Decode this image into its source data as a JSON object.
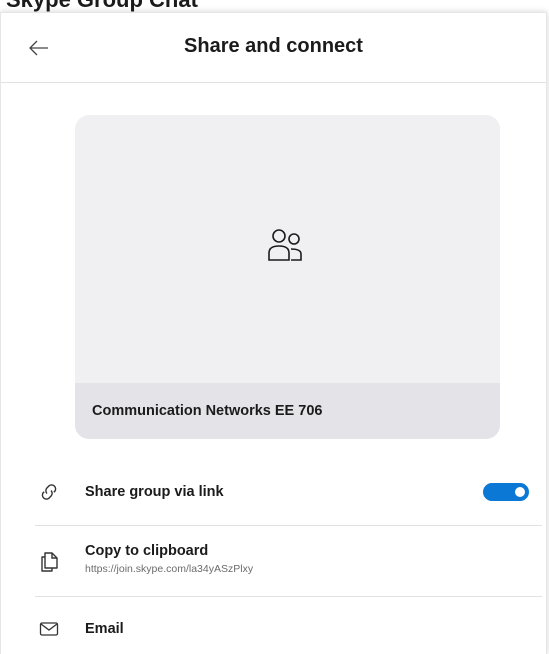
{
  "background_window": {
    "partial_title": "Skype Group Chat"
  },
  "header": {
    "back_icon": "arrow-left-icon",
    "title": "Share and connect"
  },
  "group_card": {
    "icon": "group-people-icon",
    "name": "Communication Networks EE 706"
  },
  "options": [
    {
      "icon": "link-icon",
      "label": "Share group via link",
      "toggle_on": true
    },
    {
      "icon": "copy-icon",
      "label": "Copy to clipboard",
      "sublabel": "https://join.skype.com/la34yASzPlxy"
    },
    {
      "icon": "mail-icon",
      "label": "Email"
    }
  ],
  "colors": {
    "accent": "#0a78d4",
    "card_bg": "#f0f0f2",
    "card_footer_bg": "#e3e3e8",
    "divider": "#e2e2e2"
  }
}
